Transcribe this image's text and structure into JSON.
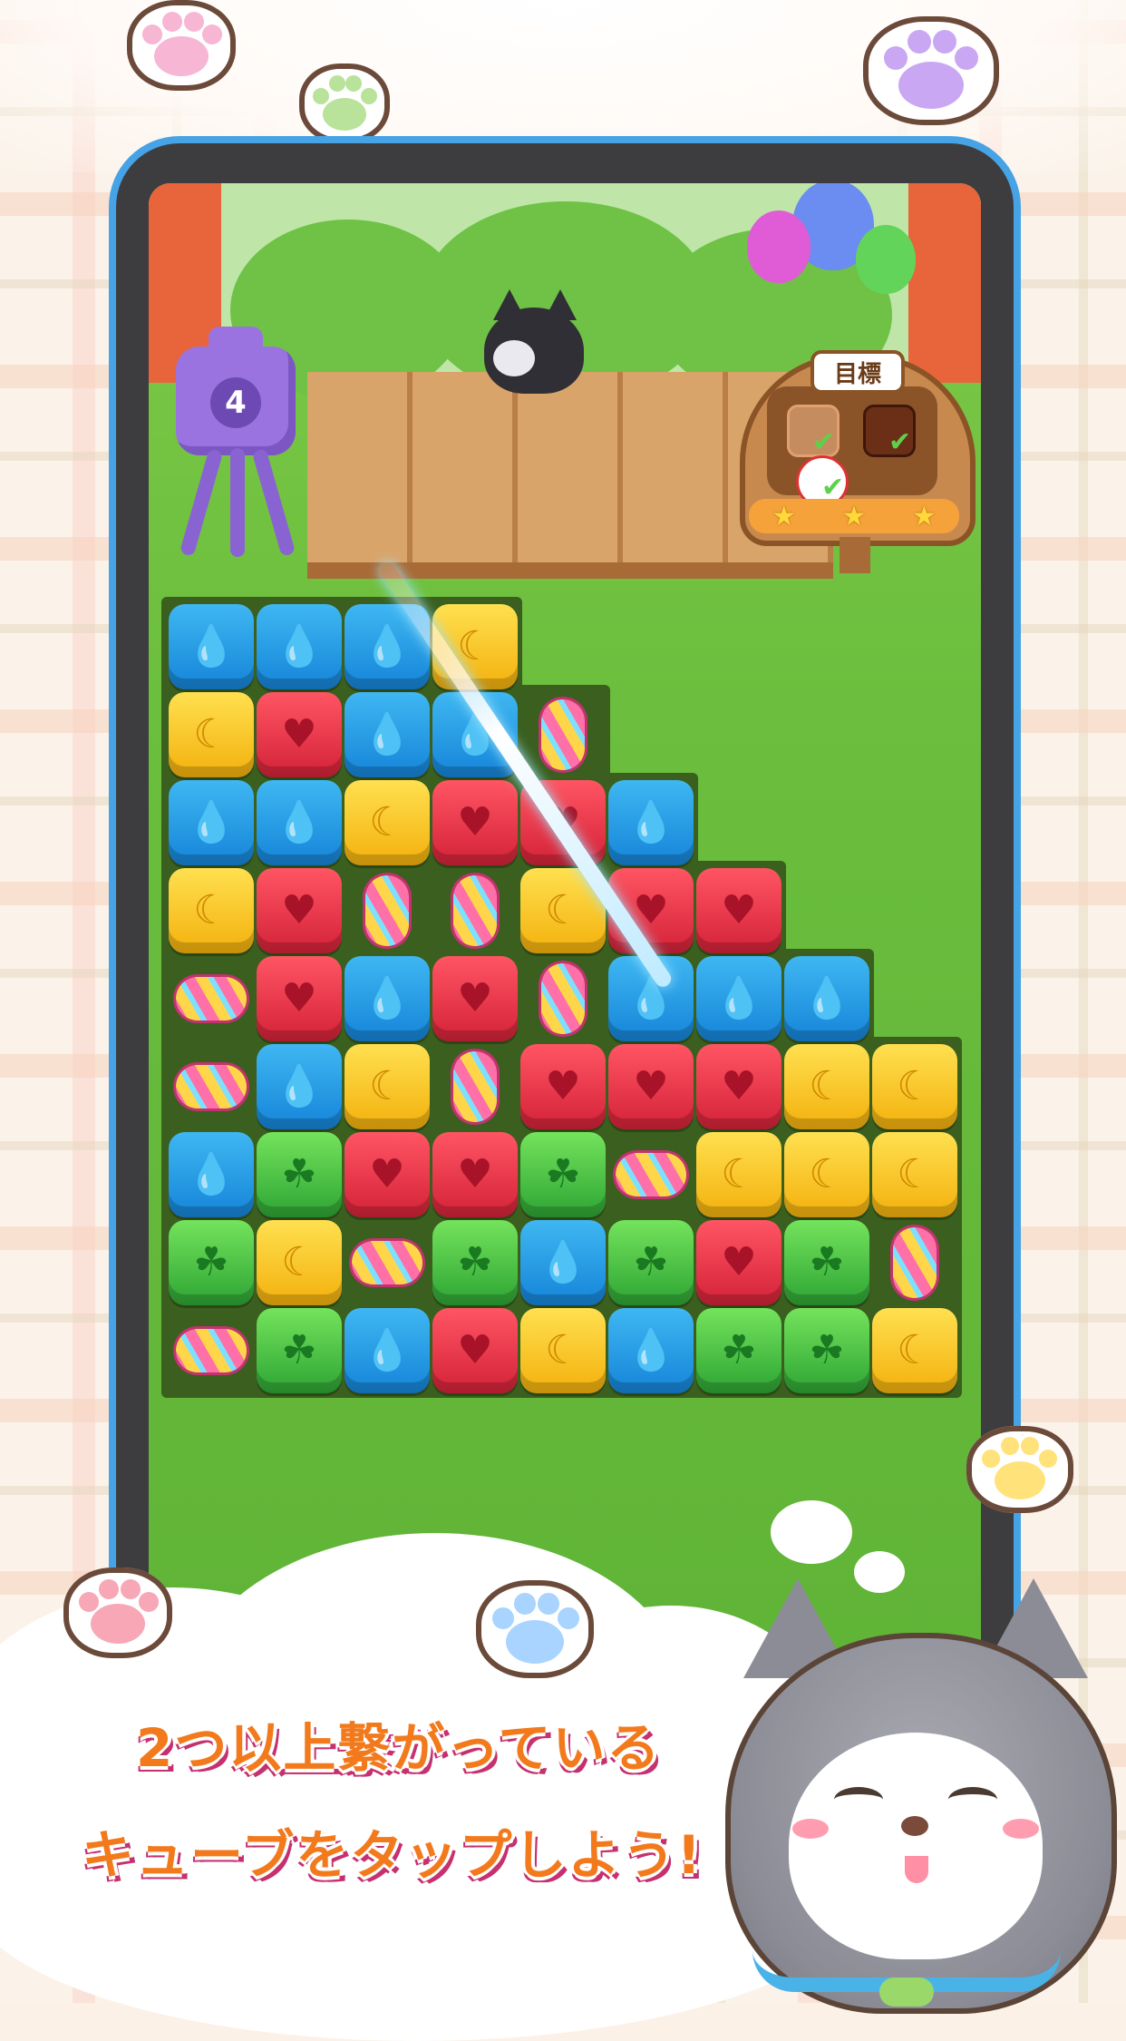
{
  "screen": {
    "width": 1242,
    "height": 2208
  },
  "game": {
    "moves_left": "4",
    "goal": {
      "title": "目標",
      "items": [
        {
          "name": "jelly-block-goal",
          "complete": true
        },
        {
          "name": "chocolate-block-goal",
          "complete": true
        },
        {
          "name": "baseball-goal",
          "complete": true
        }
      ],
      "stars": [
        "★",
        "★",
        "★"
      ]
    },
    "board": {
      "columns": 9,
      "rows": 9,
      "grid": [
        [
          "blue",
          "blue",
          "blue",
          "yellow",
          null,
          null,
          null,
          null,
          null
        ],
        [
          "yellow",
          "red",
          "blue",
          "blue",
          "candy-v",
          null,
          null,
          null,
          null
        ],
        [
          "blue",
          "blue",
          "yellow",
          "red",
          "red",
          "blue",
          null,
          null,
          null
        ],
        [
          "yellow",
          "red",
          "candy-v",
          "candy-v",
          "yellow",
          "red",
          "red",
          null,
          null
        ],
        [
          "candy",
          "red",
          "blue",
          "red",
          "candy-v",
          "blue",
          "blue",
          "blue",
          null
        ],
        [
          "candy",
          "blue",
          "yellow",
          "candy-v",
          "red",
          "red",
          "red",
          "yellow",
          "yellow"
        ],
        [
          "blue",
          "green",
          "red",
          "red",
          "green",
          "candy",
          "yellow",
          "yellow",
          "yellow"
        ],
        [
          "green",
          "yellow",
          "candy",
          "green",
          "blue",
          "green",
          "red",
          "green",
          "candy-v"
        ],
        [
          "candy",
          "green",
          "blue",
          "red",
          "yellow",
          "blue",
          "green",
          "green",
          "yellow"
        ]
      ],
      "symbols": {
        "blue": "💧",
        "red": "♥",
        "yellow": "☾",
        "green": "☘"
      }
    }
  },
  "caption": {
    "line1": "2つ以上繋がっている",
    "line2": "キューブをタップしよう!"
  },
  "colors": {
    "phone_frame": "#3d3d3f",
    "phone_border": "#45a3e6",
    "caption_text": "#f27a1c",
    "caption_outline": "#c6306e"
  }
}
